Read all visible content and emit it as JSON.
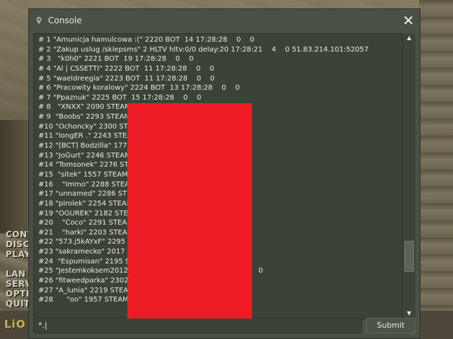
{
  "background": {
    "menu_fragments": [
      "CONT",
      "DISC",
      "PLAY",
      "LAN G",
      "SERV",
      "OPTI",
      "QUIT"
    ],
    "logo_fragment": "LiO"
  },
  "console": {
    "title": "Console",
    "close_icon": "close-icon",
    "log_lines": [
      "# 1 \"Amunicja hamulcowa :(\" 2220 BOT  14 17:28:28    0    0",
      "# 2 \"Zakup uslug /sklepsms\" 2 HLTV hltv:0/0 delay:20 17:28:21    4    0 51.83.214.101:52057",
      "# 3   \"k0h0\" 2221 BOT  19 17:28:28    0    0",
      "# 4 \"Al | CSSETTI\" 2222 BOT  11 17:28:28    0    0",
      "# 5 \"waeldreegia\" 2223 BOT  11 17:28:28    0    0",
      "# 6 \"Pracowity koralowy\" 2224 BOT  13 17:28:28    0    0",
      "# 7 \"Ppaznuk\" 2225 BOT  15 17:28:28    0    0",
      "# 8   \"XNXX\" 2090 STEAM_",
      "# 9  \"Boobs\" 2293 STEAM_",
      "#10 \"Ochoncky\" 2300 STEA                                         1",
      "#11 \"longER .\" 2243 STEAM                                        0",
      "#12 \"[BCT] Bodzilla\" 1772 S                                      24    0",
      "#13 \"JoGurt\" 2246 STEAM_",
      "#14 \"Tomsonek\" 2276 STEA",
      "#15  \"sitek\" 1557 STEAM_C",
      "#16    \"Immo\" 2288 STEAM_",
      "#17 \"unnamed\" 2286 STEA",
      "#18 \"pirolek\" 2254 STEAM_",
      "#19 \"OGUREK\" 2182 STEAM                                   0",
      "#20    \"Coco\" 2291 STEAM_",
      "#21    \"harki\" 2203 STEAM_",
      "#22 \"573.j5kAYxF\" 2295 ST",
      "#23 \"sakramecko\" 2017 ST                                      32    0",
      "#24  \"Espumisan\" 2195 STEA                                     3",
      "#25 \"Jestemkoksem2012pl                                        :49    9    0",
      "#26 \"fitweedparka\" 2302 S                                          0",
      "#27 \"A_lunia\" 2219 STEAM",
      "#28      \"oo\" 1957 STEAM_1"
    ],
    "input_value": "*.|",
    "submit_label": "Submit"
  }
}
